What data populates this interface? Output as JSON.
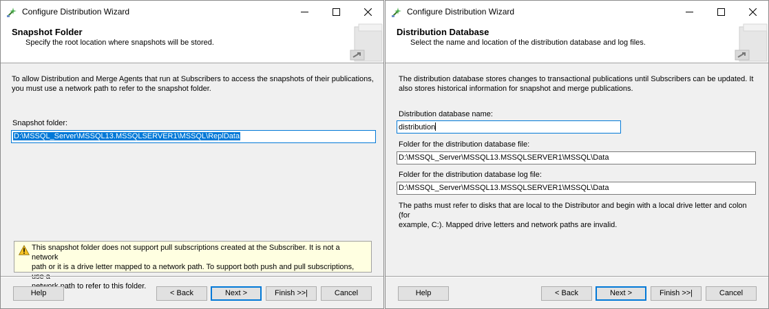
{
  "colors": {
    "selection": "#0078d7",
    "warning_bg": "#ffffe1",
    "window_bg": "#f0f0f0"
  },
  "window_left": {
    "title": "Configure Distribution Wizard",
    "icons": {
      "app": "wizard-app-icon",
      "minimize": "minimize-icon",
      "maximize": "maximize-icon",
      "close": "close-icon"
    },
    "page_title": "Snapshot Folder",
    "page_subtitle": "Specify the root location where snapshots will be stored.",
    "description_line1": "To allow Distribution and Merge Agents that run at Subscribers to access the snapshots of their publications,",
    "description_line2": "you must use a network path to refer to the snapshot folder.",
    "snapshot_label": "Snapshot folder:",
    "snapshot_value": "D:\\MSSQL_Server\\MSSQL13.MSSQLSERVER1\\MSSQL\\ReplData",
    "warning_line1": "This snapshot folder does not support pull subscriptions created at the Subscriber. It is not a network",
    "warning_line2": "path or it is a drive letter mapped to a network path. To support both push and pull subscriptions, use a",
    "warning_line3": "network path to refer to this folder.",
    "buttons": {
      "help": "Help",
      "back": "< Back",
      "next": "Next >",
      "finish": "Finish >>|",
      "cancel": "Cancel"
    }
  },
  "window_right": {
    "title": "Configure Distribution Wizard",
    "icons": {
      "app": "wizard-app-icon",
      "minimize": "minimize-icon",
      "maximize": "maximize-icon",
      "close": "close-icon"
    },
    "page_title": "Distribution Database",
    "page_subtitle": "Select the name and location of the distribution database and log files.",
    "description_line1": "The distribution database stores changes to transactional publications until Subscribers can be updated. It",
    "description_line2": "also stores historical information for snapshot and merge publications.",
    "db_name_label": "Distribution database name:",
    "db_name_value": "distribution",
    "db_file_label": "Folder for the distribution database file:",
    "db_file_value": "D:\\MSSQL_Server\\MSSQL13.MSSQLSERVER1\\MSSQL\\Data",
    "log_file_label": "Folder for the distribution database log file:",
    "log_file_value": "D:\\MSSQL_Server\\MSSQL13.MSSQLSERVER1\\MSSQL\\Data",
    "paths_note_line1": "The paths must refer to disks that are local to the Distributor and begin with a local drive letter and colon (for",
    "paths_note_line2": "example, C:). Mapped drive letters and network paths are invalid.",
    "buttons": {
      "help": "Help",
      "back": "< Back",
      "next": "Next >",
      "finish": "Finish >>|",
      "cancel": "Cancel"
    }
  }
}
